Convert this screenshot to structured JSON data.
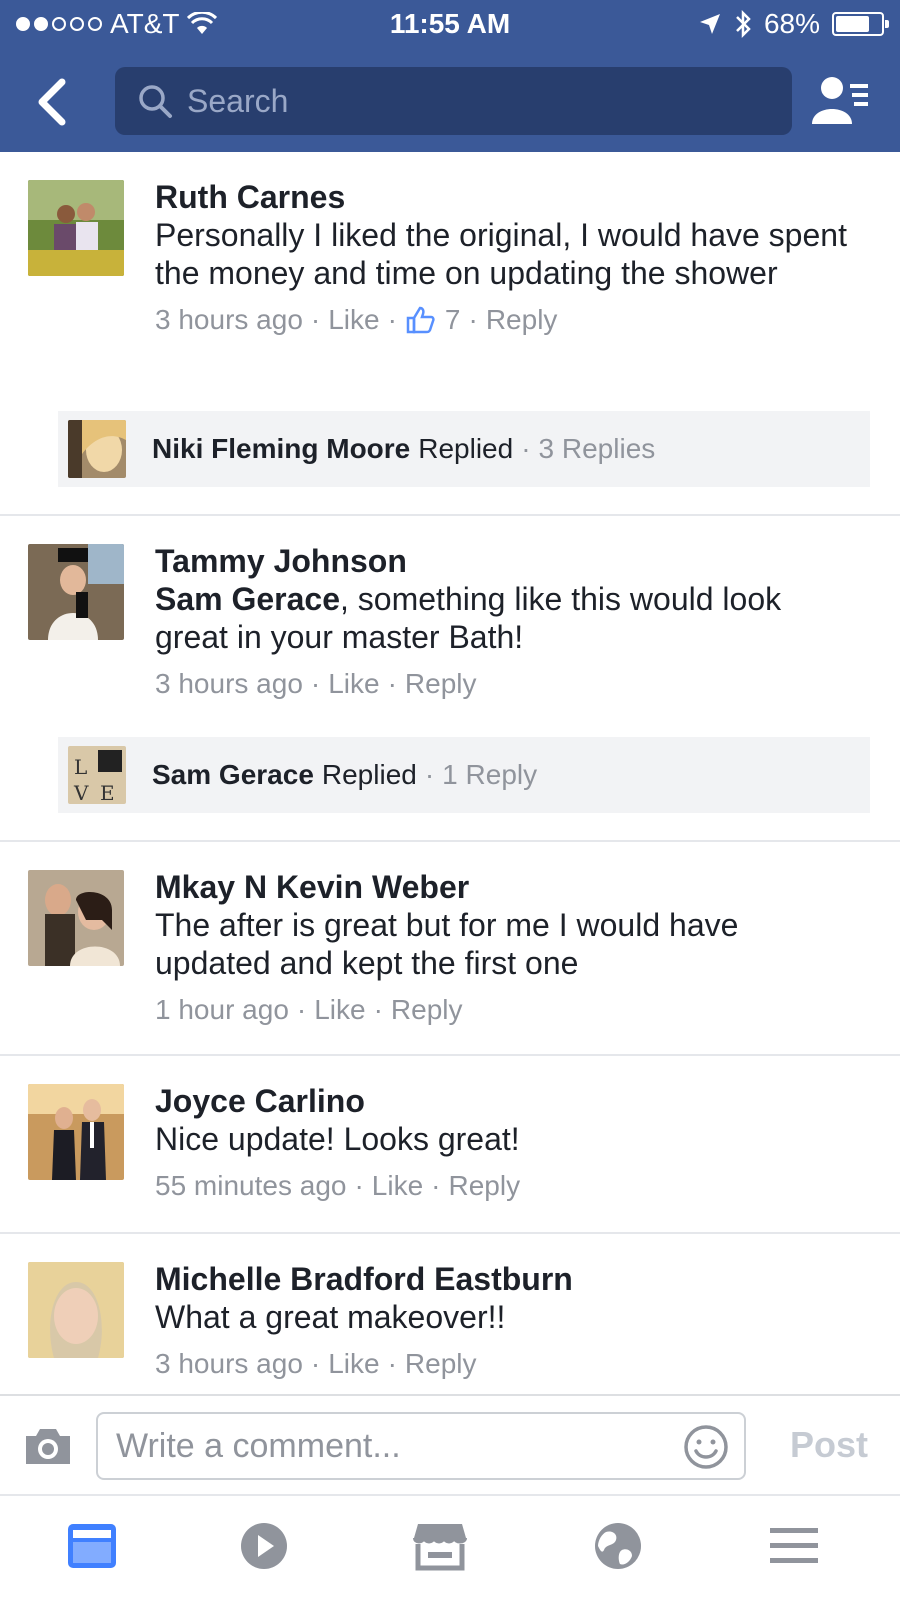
{
  "status": {
    "carrier": "AT&T",
    "time": "11:55 AM",
    "battery": "68%",
    "signal_filled": 2,
    "signal_total": 5
  },
  "nav": {
    "search_placeholder": "Search"
  },
  "comments": [
    {
      "author": "Ruth Carnes",
      "mention": "",
      "text": "Personally I liked the original, I would have spent the money and time on updating the shower",
      "time": "3 hours ago",
      "like": "Like",
      "likes": "7",
      "reply": "Reply",
      "replies": {
        "name": "Niki Fleming Moore",
        "word": "Replied",
        "count": "3 Replies"
      }
    },
    {
      "author": "Tammy Johnson",
      "mention": "Sam Gerace",
      "text": ", something like this would look great in your master Bath!",
      "time": "3 hours ago",
      "like": "Like",
      "reply": "Reply",
      "replies": {
        "name": "Sam Gerace",
        "word": "Replied",
        "count": "1 Reply"
      }
    },
    {
      "author": "Mkay N Kevin Weber",
      "text": "The after is great but for me I would have updated and kept the first one",
      "time": "1 hour ago",
      "like": "Like",
      "reply": "Reply"
    },
    {
      "author": "Joyce Carlino",
      "text": "Nice update! Looks great!",
      "time": "55 minutes ago",
      "like": "Like",
      "reply": "Reply"
    },
    {
      "author": "Michelle Bradford Eastburn",
      "text": "What a great makeover!!",
      "time": "3 hours ago",
      "like": "Like",
      "reply": "Reply"
    }
  ],
  "composer": {
    "placeholder": "Write a comment...",
    "post_label": "Post"
  },
  "tabs": [
    "news-feed-icon",
    "video-icon",
    "marketplace-icon",
    "notifications-globe-icon",
    "menu-icon"
  ],
  "colors": {
    "brand_blue": "#3b5998",
    "search_bg": "#283e6e",
    "meta_gray": "#90949c",
    "active_tab": "#4080ff"
  }
}
